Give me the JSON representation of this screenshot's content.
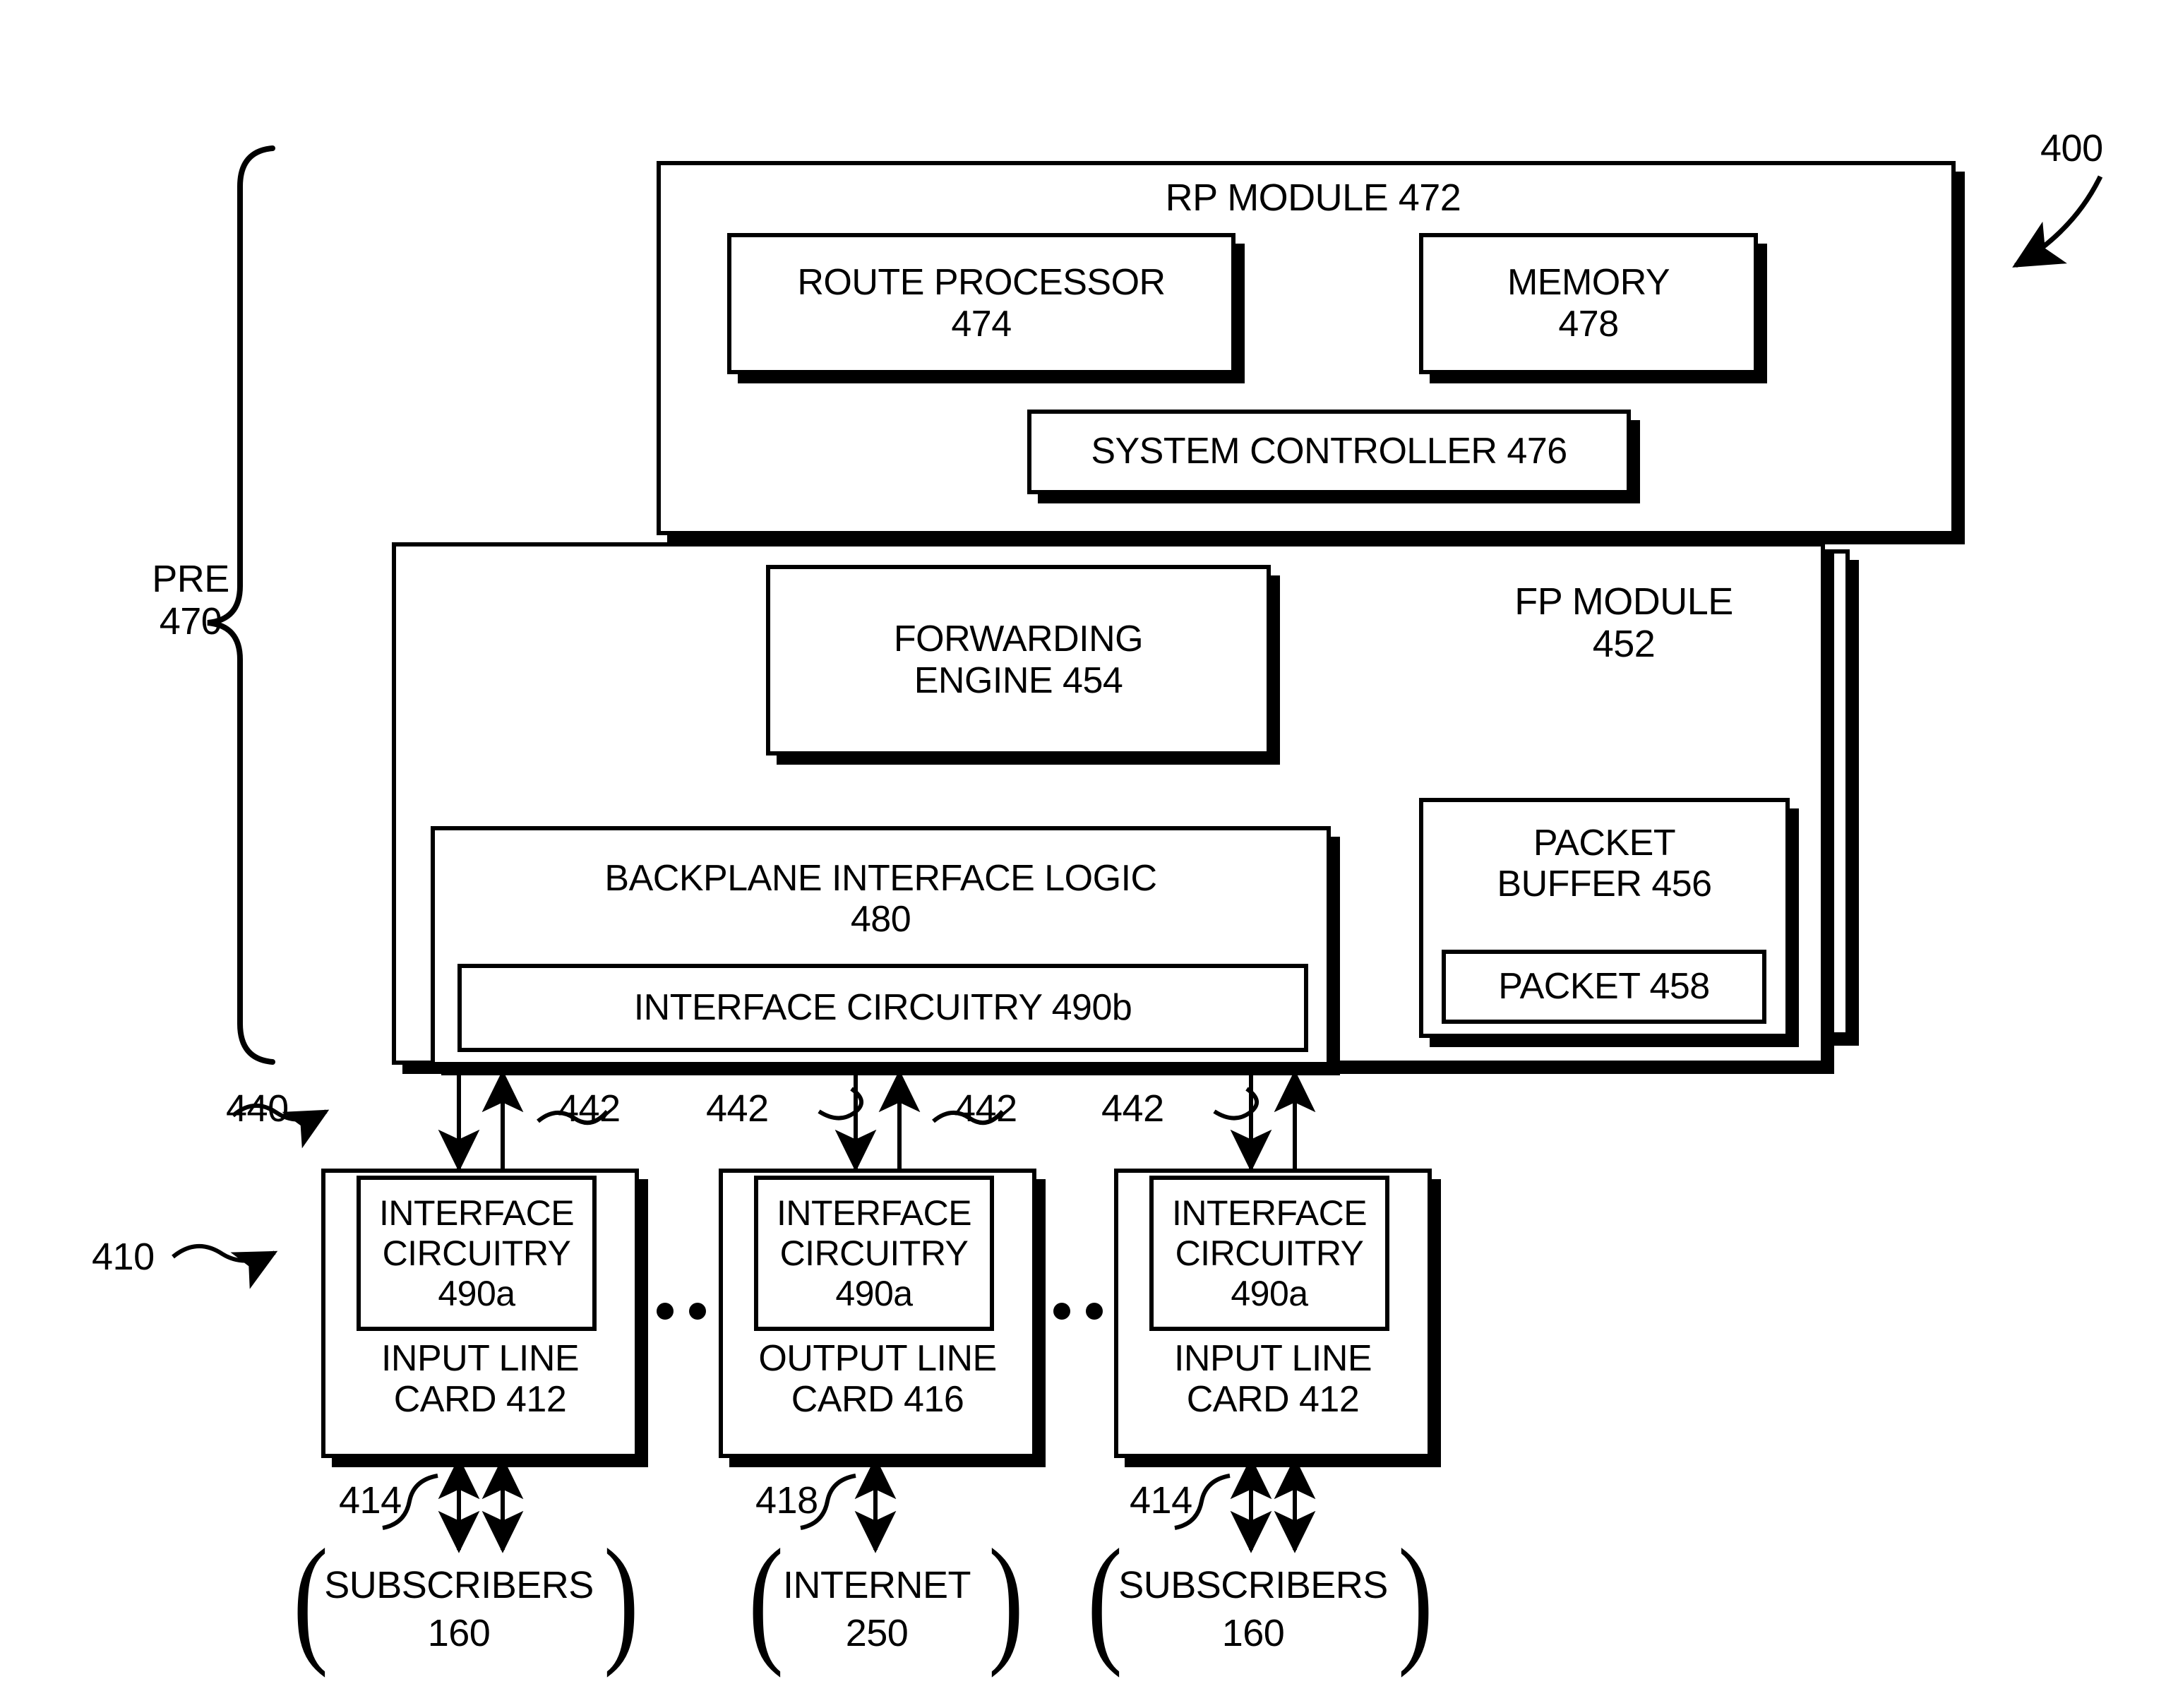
{
  "figure": {
    "ref_number": "400",
    "pre_label": "PRE\n470",
    "line_cards_ref": "410",
    "backplane_ref": "440"
  },
  "rp_module": {
    "title": "RP MODULE   472",
    "route_processor": "ROUTE PROCESSOR\n474",
    "memory": "MEMORY\n478",
    "system_controller": "SYSTEM CONTROLLER  476"
  },
  "fp_module": {
    "title": "FP MODULE\n452",
    "forwarding_engine": "FORWARDING\nENGINE  454",
    "backplane_interface_logic": "BACKPLANE INTERFACE LOGIC\n480",
    "interface_circuitry": "INTERFACE CIRCUITRY 490b",
    "packet_buffer": "PACKET\nBUFFER  456",
    "packet": "PACKET  458"
  },
  "bus_labels": {
    "b1": "442",
    "b2": "442",
    "b3": "442",
    "b4": "442"
  },
  "line_cards": [
    {
      "interface_circuitry": "INTERFACE\nCIRCUITRY\n490a",
      "card": "INPUT LINE\nCARD 412",
      "link_ref": "414",
      "endpoint_open": "(",
      "endpoint_name": "SUBSCRIBERS",
      "endpoint_number": "160",
      "endpoint_close": ")"
    },
    {
      "interface_circuitry": "INTERFACE\nCIRCUITRY\n490a",
      "card": "OUTPUT LINE\nCARD 416",
      "link_ref": "418",
      "endpoint_open": "(",
      "endpoint_name": "INTERNET",
      "endpoint_number": "250",
      "endpoint_close": ")"
    },
    {
      "interface_circuitry": "INTERFACE\nCIRCUITRY\n490a",
      "card": "INPUT LINE\nCARD 412",
      "link_ref": "414",
      "endpoint_open": "(",
      "endpoint_name": "SUBSCRIBERS",
      "endpoint_number": "160",
      "endpoint_close": ")"
    }
  ]
}
